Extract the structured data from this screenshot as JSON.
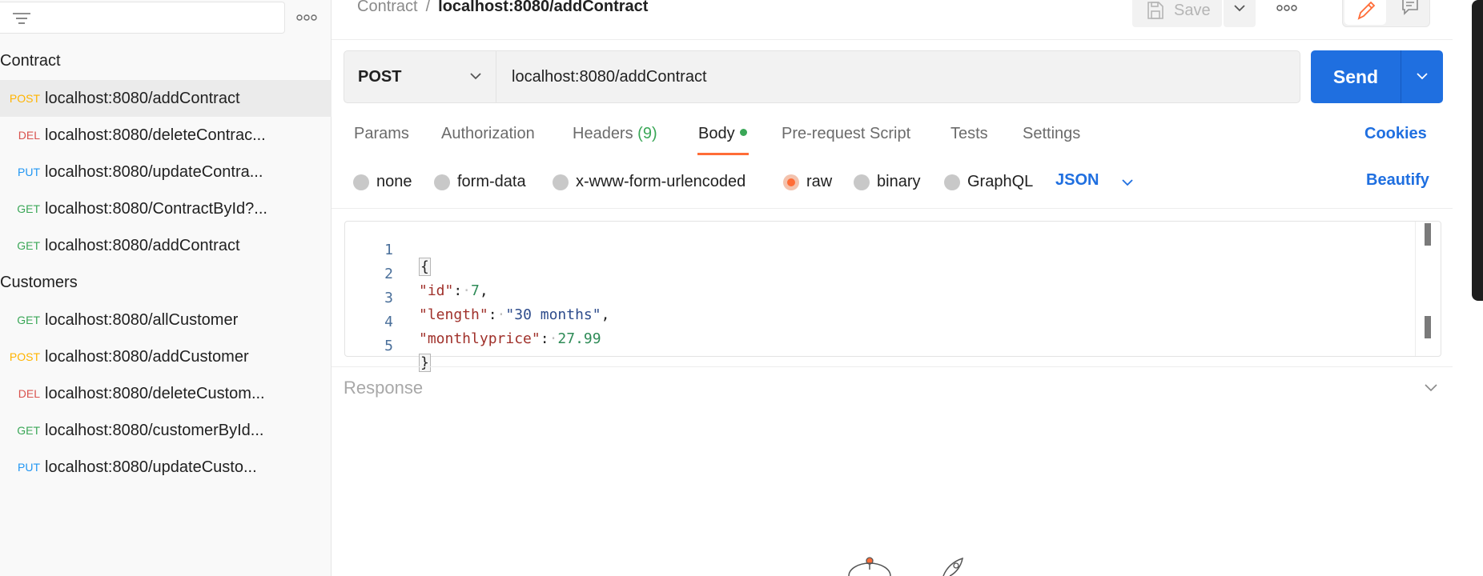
{
  "sidebar": {
    "folders": [
      {
        "name": "Contract",
        "requests": [
          {
            "method": "POST",
            "name": "localhost:8080/addContract"
          },
          {
            "method": "DEL",
            "name": "localhost:8080/deleteContrac..."
          },
          {
            "method": "PUT",
            "name": "localhost:8080/updateContra..."
          },
          {
            "method": "GET",
            "name": "localhost:8080/ContractById?..."
          },
          {
            "method": "GET",
            "name": "localhost:8080/addContract"
          }
        ]
      },
      {
        "name": "Customers",
        "requests": [
          {
            "method": "GET",
            "name": "localhost:8080/allCustomer"
          },
          {
            "method": "POST",
            "name": "localhost:8080/addCustomer"
          },
          {
            "method": "DEL",
            "name": "localhost:8080/deleteCustom..."
          },
          {
            "method": "GET",
            "name": "localhost:8080/customerById..."
          },
          {
            "method": "PUT",
            "name": "localhost:8080/updateCusto..."
          }
        ]
      }
    ]
  },
  "breadcrumb": {
    "collection": "Contract",
    "separator": "/",
    "request": "localhost:8080/addContract"
  },
  "toolbar": {
    "save_label": "Save"
  },
  "request": {
    "method": "POST",
    "url": "localhost:8080/addContract",
    "send_label": "Send"
  },
  "tabs": {
    "params": "Params",
    "authorization": "Authorization",
    "headers": "Headers",
    "headers_count": "(9)",
    "body": "Body",
    "prerequest": "Pre-request Script",
    "tests": "Tests",
    "settings": "Settings",
    "cookies": "Cookies"
  },
  "body_options": {
    "none": "none",
    "form_data": "form-data",
    "urlencoded": "x-www-form-urlencoded",
    "raw": "raw",
    "binary": "binary",
    "graphql": "GraphQL",
    "selected": "raw",
    "language": "JSON",
    "beautify": "Beautify"
  },
  "editor": {
    "line_numbers": [
      "1",
      "2",
      "3",
      "4",
      "5"
    ],
    "open_brace": "{",
    "close_brace": "}",
    "lines": [
      {
        "key": "\"id\"",
        "value": "7",
        "value_type": "number",
        "comma": ","
      },
      {
        "key": "\"length\"",
        "value": "\"30 months\"",
        "value_type": "string",
        "comma": ","
      },
      {
        "key": "\"monthlyprice\"",
        "value": "27.99",
        "value_type": "number",
        "comma": ""
      }
    ]
  },
  "response": {
    "title": "Response"
  },
  "colors": {
    "accent": "#1f6fe0",
    "tab_indicator": "#ff6c37",
    "post": "#ffb400",
    "get": "#3aa757",
    "put": "#2196f3",
    "delete": "#d9534f"
  },
  "icons": {
    "filter": "filter-icon",
    "more": "more-horizontal-icon",
    "save": "save-icon",
    "chevron": "chevron-down-icon",
    "edit": "pencil-icon",
    "comment": "comment-icon"
  }
}
